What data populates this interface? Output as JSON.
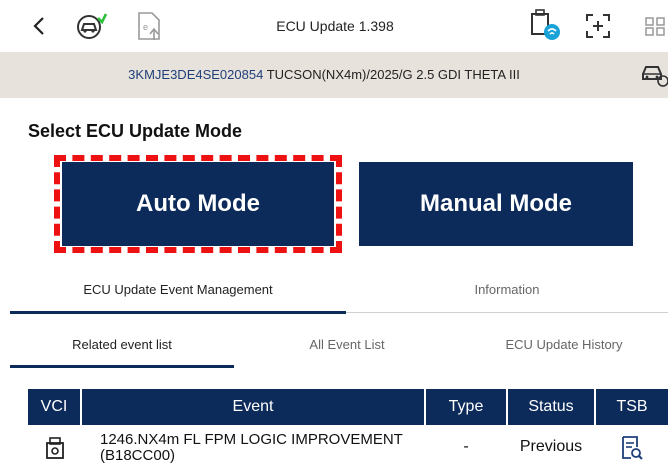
{
  "header": {
    "title": "ECU Update 1.398",
    "icons": {
      "back": "chevron-left-icon",
      "vehicle_gear": "vehicle-gear-icon",
      "document_upload": "document-upload-icon",
      "ecu_wireless": "ecu-wireless-icon",
      "expand": "expand-icon",
      "grid": "grid-icon"
    }
  },
  "vehicle_bar": {
    "vin": "3KMJE3DE4SE020854",
    "model": "TUCSON(NX4m)/2025/G 2.5 GDI THETA III",
    "icon": "car-check-icon"
  },
  "main": {
    "section_title": "Select ECU Update Mode",
    "auto_label": "Auto Mode",
    "manual_label": "Manual Mode"
  },
  "tabs_primary": [
    {
      "label": "ECU Update Event Management",
      "active": true
    },
    {
      "label": "Information",
      "active": false
    }
  ],
  "tabs_secondary": [
    {
      "label": "Related event list",
      "active": true
    },
    {
      "label": "All Event List",
      "active": false
    },
    {
      "label": "ECU Update History",
      "active": false
    }
  ],
  "table": {
    "headers": [
      "VCI",
      "Event",
      "Type",
      "Status",
      "TSB"
    ],
    "rows": [
      {
        "vci_icon": "vci-device-icon",
        "event": "1246.NX4m FL FPM LOGIC IMPROVEMENT (B18CC00)",
        "type": "-",
        "status": "Previous",
        "tsb_icon": "document-search-icon"
      }
    ]
  },
  "colors": {
    "primary_navy": "#0c2b5a",
    "vin_blue": "#1f3f79",
    "highlight_red": "#ee1111",
    "vehicle_bar_bg": "#e8e2dc"
  }
}
